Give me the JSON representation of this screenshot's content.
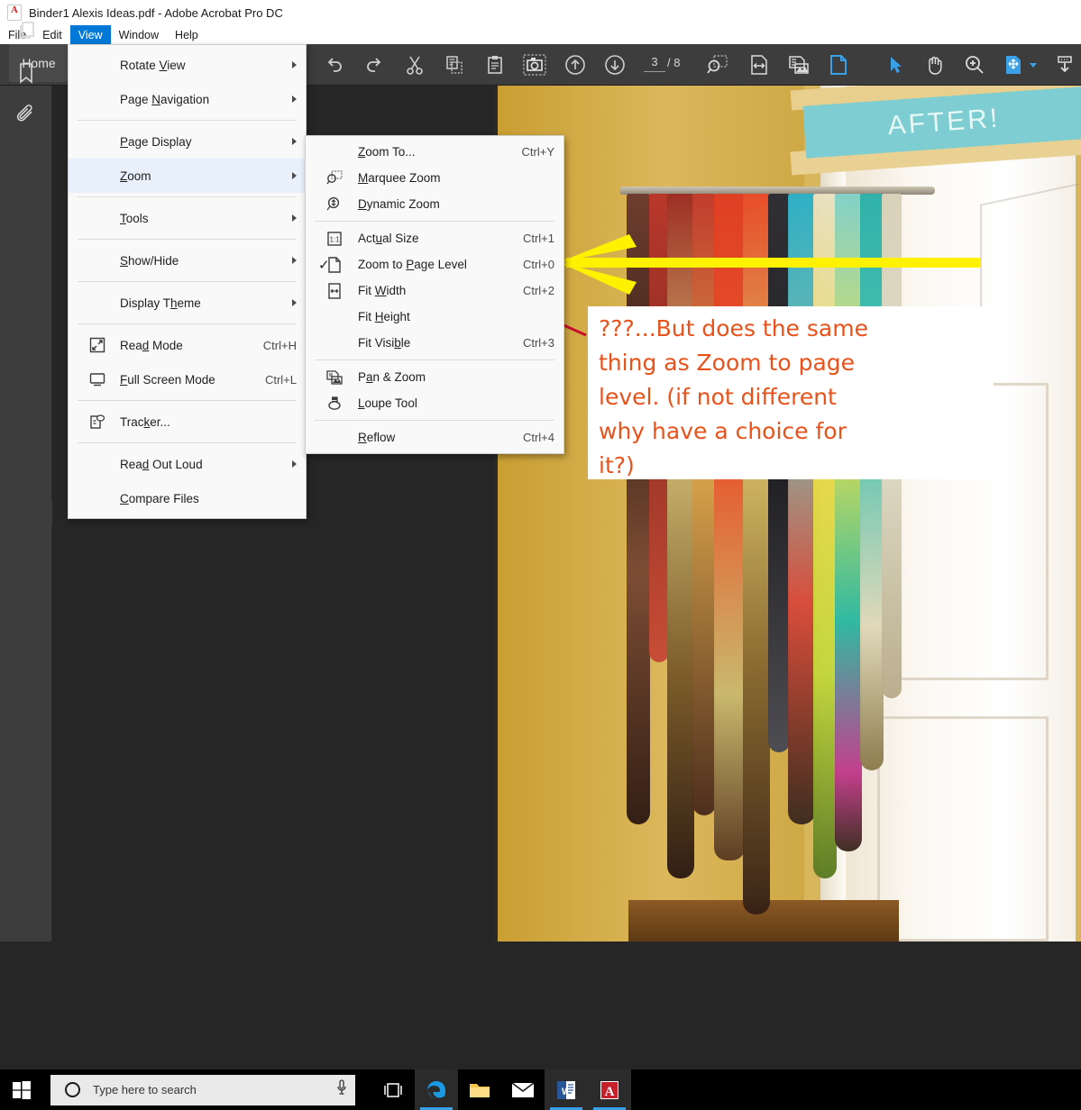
{
  "titlebar": {
    "icon": "acrobat-pdf-icon",
    "title": "Binder1 Alexis Ideas.pdf - Adobe Acrobat Pro DC"
  },
  "menubar": {
    "items": [
      {
        "label": "File",
        "active": false
      },
      {
        "label": "Edit",
        "active": false
      },
      {
        "label": "View",
        "active": true
      },
      {
        "label": "Window",
        "active": false
      },
      {
        "label": "Help",
        "active": false
      }
    ]
  },
  "toolbar": {
    "home_tab_label": "Home",
    "page_current": "3",
    "page_total": "/ 8",
    "icons": [
      "undo-icon",
      "redo-icon",
      "cut-icon",
      "copy-icon",
      "paste-icon",
      "snapshot-camera-icon",
      "previous-page-up-icon",
      "next-page-down-icon",
      "marquee-zoom-icon",
      "fit-width-icon",
      "pan-and-zoom-icon",
      "zoom-page-level-icon",
      "select-cursor-icon",
      "hand-tool-icon",
      "zoom-in-icon",
      "organize-pages-icon",
      "organize-pages-chevron-icon",
      "download-icon"
    ]
  },
  "left_rail": {
    "icons": [
      "page-thumbnails-icon",
      "bookmarks-icon",
      "attachments-icon"
    ],
    "collapse_handle": "collapse-panel-icon"
  },
  "view_menu": {
    "items": [
      {
        "label": "Rotate View",
        "accel": "",
        "submenu": true,
        "icon": "",
        "checked": false,
        "underline": "V"
      },
      {
        "label": "Page Navigation",
        "accel": "",
        "submenu": true,
        "icon": "",
        "checked": false,
        "underline": "N"
      },
      {
        "sep": true
      },
      {
        "label": "Page Display",
        "accel": "",
        "submenu": true,
        "icon": "",
        "checked": false,
        "underline": "P"
      },
      {
        "label": "Zoom",
        "accel": "",
        "submenu": true,
        "icon": "",
        "checked": false,
        "highlight": true,
        "underline": "Z"
      },
      {
        "sep": true
      },
      {
        "label": "Tools",
        "accel": "",
        "submenu": true,
        "icon": "",
        "checked": false,
        "underline": "T"
      },
      {
        "sep": true
      },
      {
        "label": "Show/Hide",
        "accel": "",
        "submenu": true,
        "icon": "",
        "checked": false,
        "underline": "S"
      },
      {
        "sep": true
      },
      {
        "label": "Display Theme",
        "accel": "",
        "submenu": true,
        "icon": "",
        "checked": false,
        "underline": "h"
      },
      {
        "sep": true
      },
      {
        "label": "Read Mode",
        "accel": "Ctrl+H",
        "submenu": false,
        "icon": "read-mode-icon",
        "checked": false,
        "underline": "d"
      },
      {
        "label": "Full Screen Mode",
        "accel": "Ctrl+L",
        "submenu": false,
        "icon": "full-screen-icon",
        "checked": false,
        "underline": "F"
      },
      {
        "sep": true
      },
      {
        "label": "Tracker...",
        "accel": "",
        "submenu": false,
        "icon": "tracker-icon",
        "checked": false,
        "underline": "k"
      },
      {
        "sep": true
      },
      {
        "label": "Read Out Loud",
        "accel": "",
        "submenu": true,
        "icon": "",
        "checked": false,
        "underline": "d"
      },
      {
        "label": "Compare Files",
        "accel": "",
        "submenu": false,
        "icon": "",
        "checked": false,
        "underline": "C"
      }
    ]
  },
  "zoom_submenu": {
    "items": [
      {
        "label": "Zoom To...",
        "accel": "Ctrl+Y",
        "icon": "",
        "checked": false,
        "underline": "Z"
      },
      {
        "label": "Marquee Zoom",
        "accel": "",
        "icon": "marquee-zoom-icon",
        "checked": false,
        "underline": "M"
      },
      {
        "label": "Dynamic Zoom",
        "accel": "",
        "icon": "dynamic-zoom-icon",
        "checked": false,
        "underline": "D"
      },
      {
        "sep": true
      },
      {
        "label": "Actual Size",
        "accel": "Ctrl+1",
        "icon": "actual-size-icon",
        "checked": false,
        "underline": "u"
      },
      {
        "label": "Zoom to Page Level",
        "accel": "Ctrl+0",
        "icon": "page-level-icon",
        "checked": true,
        "underline": "P"
      },
      {
        "label": "Fit Width",
        "accel": "Ctrl+2",
        "icon": "fit-width-icon",
        "checked": false,
        "underline": "W"
      },
      {
        "label": "Fit Height",
        "accel": "",
        "icon": "",
        "checked": false,
        "underline": "H"
      },
      {
        "label": "Fit Visible",
        "accel": "Ctrl+3",
        "icon": "",
        "checked": false,
        "underline": "b"
      },
      {
        "sep": true
      },
      {
        "label": "Pan & Zoom",
        "accel": "",
        "icon": "pan-and-zoom-icon",
        "checked": false,
        "underline": "a"
      },
      {
        "label": "Loupe Tool",
        "accel": "",
        "icon": "loupe-tool-icon",
        "checked": false,
        "underline": "L"
      },
      {
        "sep": true
      },
      {
        "label": "Reflow",
        "accel": "Ctrl+4",
        "icon": "",
        "checked": false,
        "underline": "R"
      }
    ]
  },
  "document": {
    "banner_text": "AFTER!",
    "annotations": {
      "yellow_arrow": {
        "color": "#FFF200",
        "direction": "left",
        "points_at": "Zoom to Page Level  Ctrl+0"
      },
      "red_ellipse": {
        "color": "#C8102E",
        "encircles": "blank shortcut area beside Fit Height"
      },
      "note": {
        "color": "#E8521B",
        "background": "#FFFFFF",
        "lines": [
          "???...But does the same",
          "thing as Zoom to page",
          "level.  (if not different",
          "why have a choice for",
          "it?)"
        ]
      }
    }
  },
  "taskbar": {
    "start_icon": "windows-start-icon",
    "search_placeholder": "Type here to search",
    "cortana_icon": "cortana-circle-icon",
    "mic_icon": "microphone-icon",
    "icons": [
      {
        "name": "task-view-icon",
        "active": false
      },
      {
        "name": "microsoft-edge-icon",
        "active": true
      },
      {
        "name": "file-explorer-icon",
        "active": false
      },
      {
        "name": "mail-icon",
        "active": false
      },
      {
        "name": "microsoft-word-icon",
        "active": true
      },
      {
        "name": "adobe-acrobat-icon",
        "active": true
      }
    ]
  },
  "colors": {
    "toolbar_bg": "#3D3D3D",
    "doc_bg": "#262626",
    "menu_highlight": "#E8F0FB",
    "menubar_active": "#0078D7",
    "accent_blue": "#3AA0E8",
    "annotation_orange": "#E8521B",
    "annotation_yellow": "#FFF200",
    "annotation_red": "#C8102E",
    "banner_teal": "#7DCDD2"
  }
}
